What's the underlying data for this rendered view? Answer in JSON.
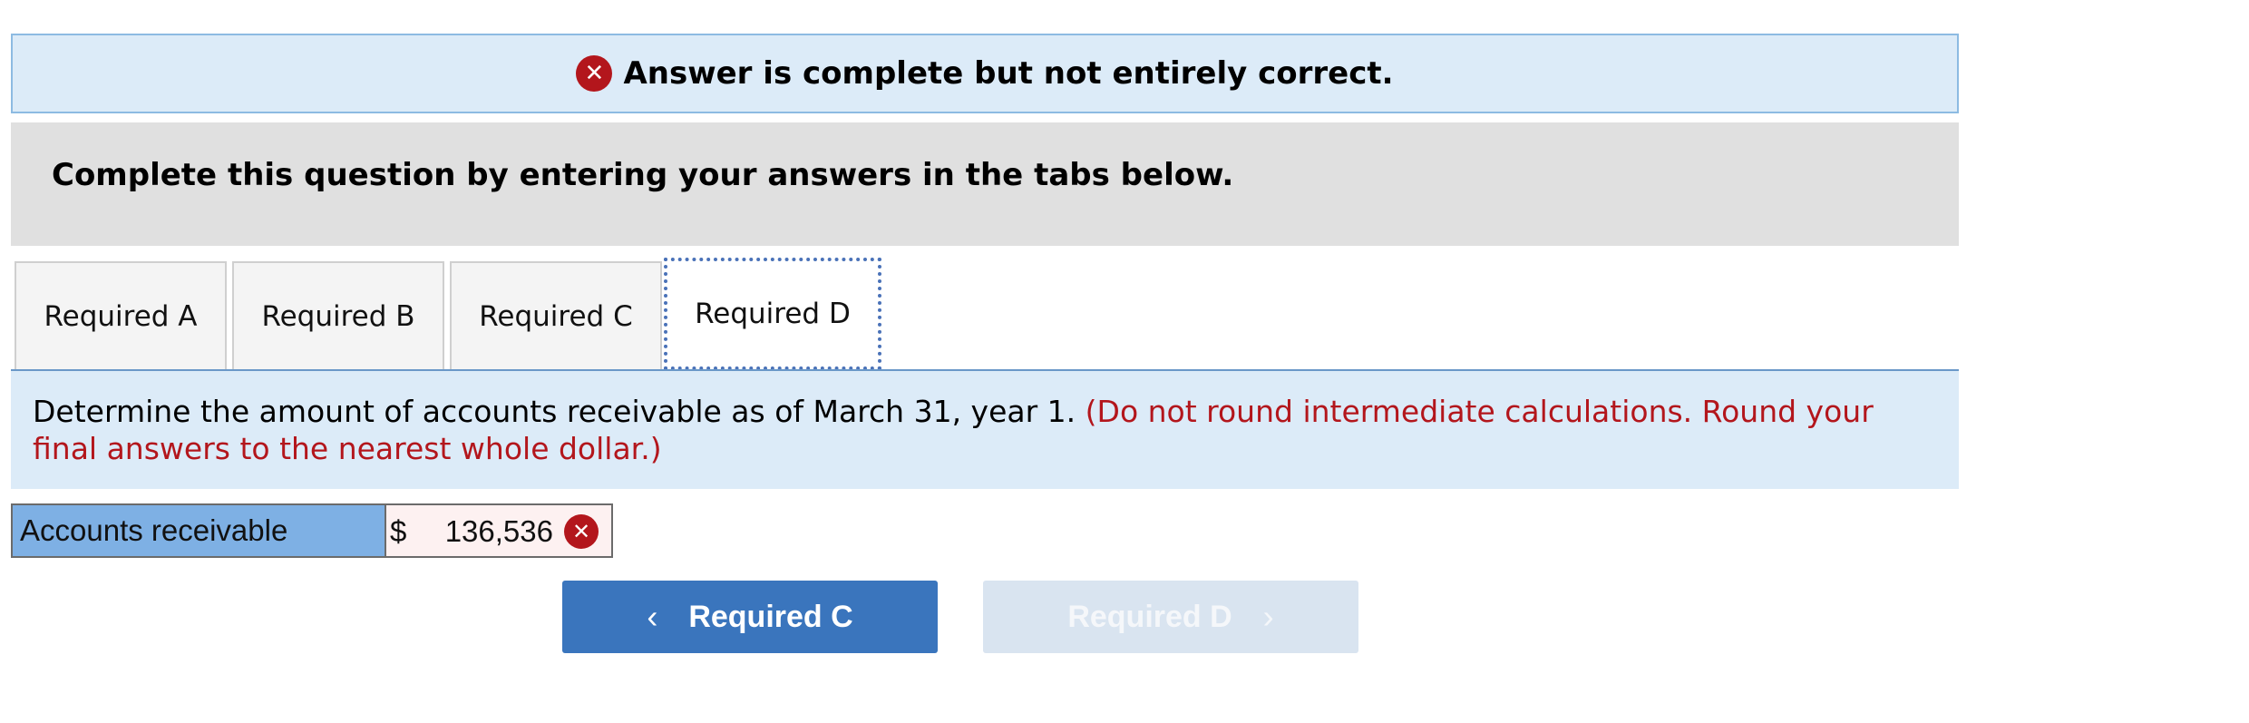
{
  "alert": {
    "icon": "x-circle-icon",
    "icon_glyph": "✕",
    "text": "Answer is complete but not entirely correct."
  },
  "instructions": "Complete this question by entering your answers in the tabs below.",
  "tabs": [
    {
      "label": "Required A",
      "active": false
    },
    {
      "label": "Required B",
      "active": false
    },
    {
      "label": "Required C",
      "active": false
    },
    {
      "label": "Required D",
      "active": true
    }
  ],
  "question": {
    "text": "Determine the amount of accounts receivable as of March 31, year 1.",
    "note": "(Do not round intermediate calculations. Round your final answers to the nearest whole dollar.)"
  },
  "answer_table": {
    "label": "Accounts receivable",
    "currency": "$",
    "value": "136,536",
    "status": "incorrect",
    "status_glyph": "✕"
  },
  "navigation": {
    "prev_label": "Required C",
    "prev_chevron": "‹",
    "next_label": "Required D",
    "next_chevron": "›",
    "next_enabled": false
  },
  "colors": {
    "alert_bg": "#dcebf8",
    "error_red": "#b3161c",
    "button_blue": "#3a75bd",
    "label_cell_blue": "#7eb0e4",
    "disabled_button": "#d9e4f0"
  }
}
